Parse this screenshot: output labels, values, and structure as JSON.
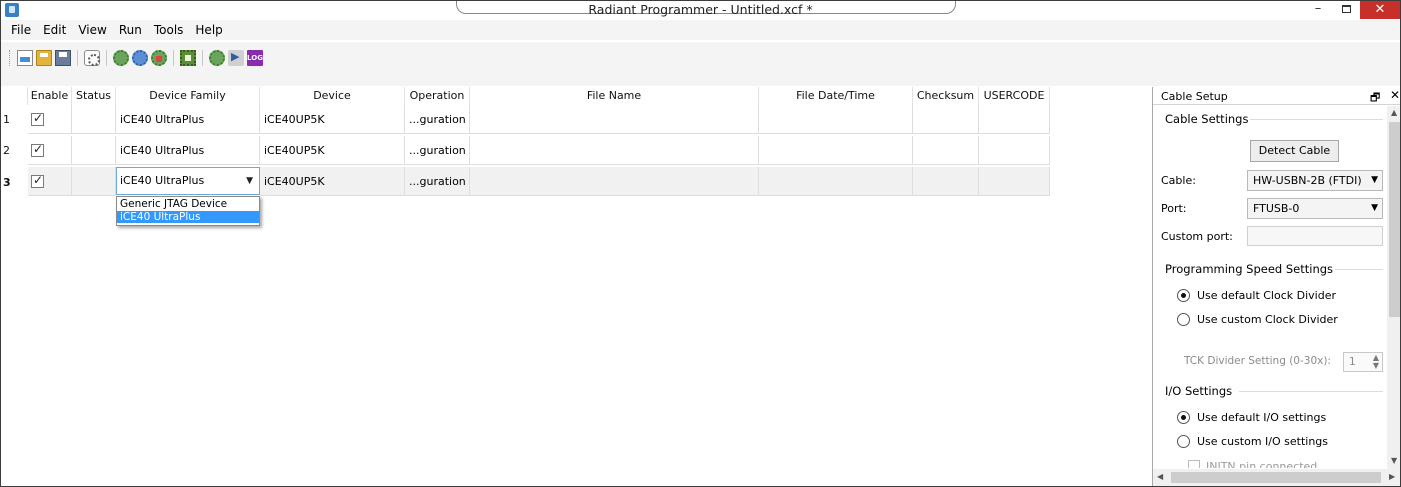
{
  "window": {
    "title": "Radiant Programmer - Untitled.xcf *",
    "minimize": "–",
    "close": "✕"
  },
  "menu": [
    "File",
    "Edit",
    "View",
    "Run",
    "Tools",
    "Help"
  ],
  "toolbar": {
    "icons": [
      "new-file-icon",
      "open-folder-icon",
      "save-icon",
      "scan-device-icon",
      "program-icon",
      "verify-icon",
      "erase-icon",
      "chip-icon",
      "program-flow-icon",
      "run-icon",
      "log-icon"
    ],
    "log_label": "LOG"
  },
  "table": {
    "headers": {
      "enable": "Enable",
      "status": "Status",
      "family": "Device Family",
      "device": "Device",
      "operation": "Operation",
      "file": "File Name",
      "datetime": "File Date/Time",
      "checksum": "Checksum",
      "usercode": "USERCODE"
    },
    "rows": [
      {
        "num": "1",
        "enabled": true,
        "status": "",
        "family": "iCE40 UltraPlus",
        "device": "iCE40UP5K",
        "operation": "...guration",
        "file": "",
        "datetime": "",
        "checksum": "",
        "usercode": ""
      },
      {
        "num": "2",
        "enabled": true,
        "status": "",
        "family": "iCE40 UltraPlus",
        "device": "iCE40UP5K",
        "operation": "...guration",
        "file": "",
        "datetime": "",
        "checksum": "",
        "usercode": ""
      },
      {
        "num": "3",
        "enabled": true,
        "status": "",
        "family": "iCE40 UltraPlus",
        "device": "iCE40UP5K",
        "operation": "...guration",
        "file": "",
        "datetime": "",
        "checksum": "",
        "usercode": ""
      }
    ],
    "family_dropdown": {
      "selected": "iCE40 UltraPlus",
      "options": [
        "Generic JTAG Device",
        "iCE40 UltraPlus"
      ]
    }
  },
  "panel": {
    "title": "Cable Setup",
    "pin": "🗗",
    "close": "✕",
    "cable_settings": {
      "title": "Cable Settings",
      "detect_button": "Detect Cable",
      "cable_label": "Cable:",
      "cable_value": "HW-USBN-2B (FTDI)",
      "port_label": "Port:",
      "port_value": "FTUSB-0",
      "custom_port_label": "Custom port:",
      "custom_port_value": ""
    },
    "speed_settings": {
      "title": "Programming Speed Settings",
      "option_default": "Use default Clock Divider",
      "option_custom": "Use custom Clock Divider",
      "selected": "default",
      "tck_label": "TCK Divider Setting (0-30x):",
      "tck_value": "1"
    },
    "io_settings": {
      "title": "I/O Settings",
      "option_default": "Use default I/O settings",
      "option_custom": "Use custom I/O settings",
      "selected": "default",
      "initn_label": "INITN pin connected"
    }
  }
}
